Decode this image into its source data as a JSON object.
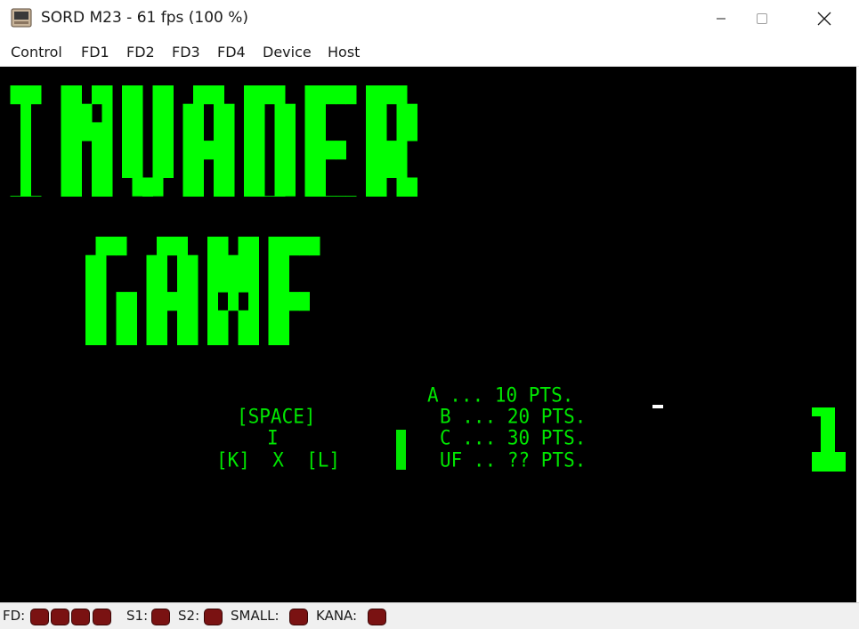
{
  "window": {
    "title": "SORD M23 - 61 fps (100 %)",
    "buttons": [
      "minimize",
      "maximize",
      "close"
    ]
  },
  "menu": {
    "items": [
      "Control",
      "FD1",
      "FD2",
      "FD3",
      "FD4",
      "Device",
      "Host"
    ]
  },
  "screen": {
    "title_line1": "INVADER",
    "title_line2": "GAME",
    "controls": {
      "space": "[SPACE]",
      "arrow": "I",
      "left_right": "[K]  X  [L]"
    },
    "scores": [
      "A ... 10 PTS.",
      "B ... 20 PTS.",
      "C ... 30 PTS.",
      "UF .. ?? PTS."
    ],
    "credit": "1",
    "colors": {
      "text": "#00e600",
      "title": "#00ff00",
      "background": "#000000"
    }
  },
  "status": {
    "fd_label": "FD:",
    "s1_label": "S1:",
    "s2_label": "S2:",
    "small_label": "SMALL:",
    "kana_label": "KANA:",
    "led_color": "#7a1212"
  }
}
